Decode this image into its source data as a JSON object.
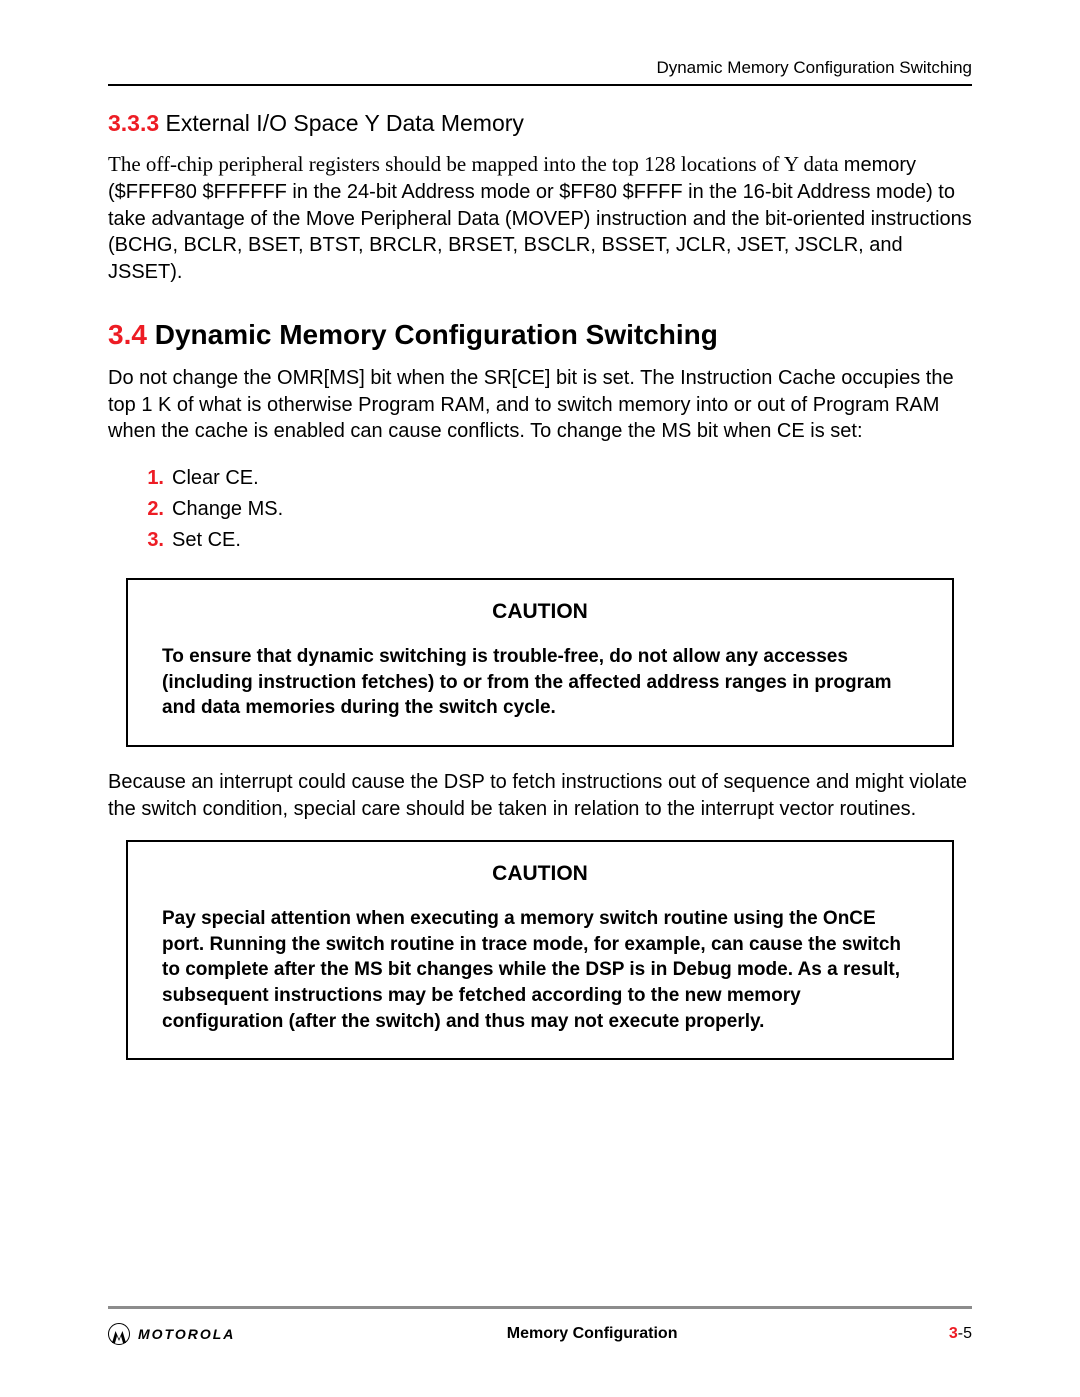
{
  "running_head": "Dynamic Memory Configuration Switching",
  "section_333": {
    "number": "3.3.3",
    "title": "External I/O Space Y Data Memory",
    "lead_sentence": "The off-chip peripheral registers should be mapped into the top 128 locations of Y data ",
    "rest": "memory ($FFFF80 $FFFFFF in the 24-bit Address mode or $FF80 $FFFF in the 16-bit Address mode) to take advantage of the Move Peripheral Data (MOVEP) instruction and the bit-oriented instructions (BCHG, BCLR, BSET, BTST, BRCLR, BRSET, BSCLR, BSSET, JCLR, JSET, JSCLR, and JSSET)."
  },
  "section_34": {
    "number": "3.4",
    "title": "Dynamic Memory Configuration Switching",
    "intro": "Do not change the OMR[MS] bit when the SR[CE] bit is set. The Instruction Cache occupies the top 1 K of what is otherwise Program RAM, and to switch memory into or out of Program RAM when the cache is enabled can cause conflicts. To change the MS bit when CE is set:",
    "steps": [
      {
        "n": "1.",
        "t": "Clear CE."
      },
      {
        "n": "2.",
        "t": "Change MS."
      },
      {
        "n": "3.",
        "t": "Set CE."
      }
    ],
    "caution1_title": "CAUTION",
    "caution1_text": "To ensure that dynamic switching is trouble-free, do not allow any accesses (including instruction fetches) to or from the affected address ranges in program and data memories during the switch cycle.",
    "between": "Because an interrupt could cause the DSP to fetch instructions out of sequence and might violate the switch condition, special care should be taken in relation to the interrupt vector routines.",
    "caution2_title": "CAUTION",
    "caution2_text": "Pay special attention when executing a memory switch routine using the OnCE port. Running the switch routine in trace mode, for example, can cause the switch to complete after the MS bit changes while the DSP is in Debug mode. As a result, subsequent instructions may be fetched according to the new memory configuration (after the switch) and thus may not execute properly."
  },
  "footer": {
    "brand": "MOTOROLA",
    "center": "Memory Configuration",
    "chapter": "3",
    "page_sep": "-",
    "page": "5"
  }
}
